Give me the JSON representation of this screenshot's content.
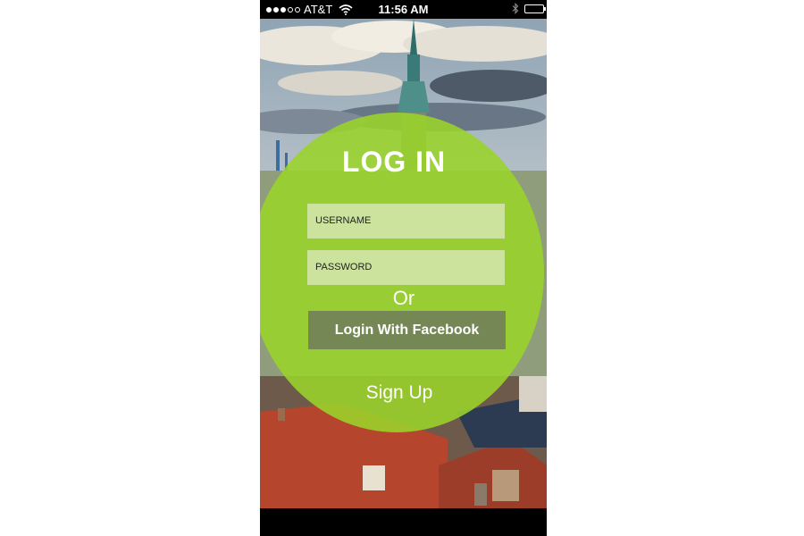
{
  "status_bar": {
    "carrier": "AT&T",
    "time": "11:56 AM",
    "signal_icon": "signal-dots-icon",
    "wifi_icon": "wifi-icon",
    "bluetooth_icon": "bluetooth-icon",
    "battery_icon": "battery-icon"
  },
  "login": {
    "title": "LOG IN",
    "username_placeholder": "USERNAME",
    "password_placeholder": "PASSWORD",
    "or_label": "Or",
    "facebook_button": "Login With Facebook",
    "signup_label": "Sign Up"
  },
  "colors": {
    "accent_green": "#9ad42a",
    "facebook_button_bg": "#6e765f"
  }
}
